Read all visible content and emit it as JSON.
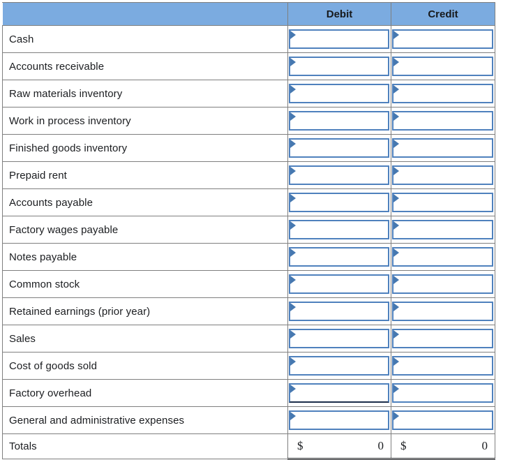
{
  "colors": {
    "header_bg": "#7BABE0",
    "grid_line": "#7f7f7f",
    "input_border": "#4F81BD",
    "marker": "#4678b0",
    "text": "#1b1d20",
    "dark_edge": "#1c2e4a"
  },
  "header": {
    "account_col_label": "",
    "debit_label": "Debit",
    "credit_label": "Credit"
  },
  "columns": [
    "",
    "Debit",
    "Credit"
  ],
  "rows": [
    {
      "label": "Cash",
      "debit": "",
      "credit": ""
    },
    {
      "label": "Accounts receivable",
      "debit": "",
      "credit": ""
    },
    {
      "label": "Raw materials inventory",
      "debit": "",
      "credit": ""
    },
    {
      "label": "Work in process inventory",
      "debit": "",
      "credit": ""
    },
    {
      "label": "Finished goods inventory",
      "debit": "",
      "credit": ""
    },
    {
      "label": "Prepaid rent",
      "debit": "",
      "credit": ""
    },
    {
      "label": "Accounts payable",
      "debit": "",
      "credit": ""
    },
    {
      "label": "Factory wages payable",
      "debit": "",
      "credit": ""
    },
    {
      "label": "Notes payable",
      "debit": "",
      "credit": ""
    },
    {
      "label": "Common stock",
      "debit": "",
      "credit": ""
    },
    {
      "label": "Retained earnings (prior year)",
      "debit": "",
      "credit": ""
    },
    {
      "label": "Sales",
      "debit": "",
      "credit": ""
    },
    {
      "label": "Cost of goods sold",
      "debit": "",
      "credit": ""
    },
    {
      "label": "Factory overhead",
      "debit": "",
      "credit": ""
    },
    {
      "label": "General and administrative expenses",
      "debit": "",
      "credit": ""
    }
  ],
  "totals": {
    "label": "Totals",
    "debit_currency": "$",
    "debit_amount": "0",
    "credit_currency": "$",
    "credit_amount": "0"
  },
  "input_placeholder": ""
}
